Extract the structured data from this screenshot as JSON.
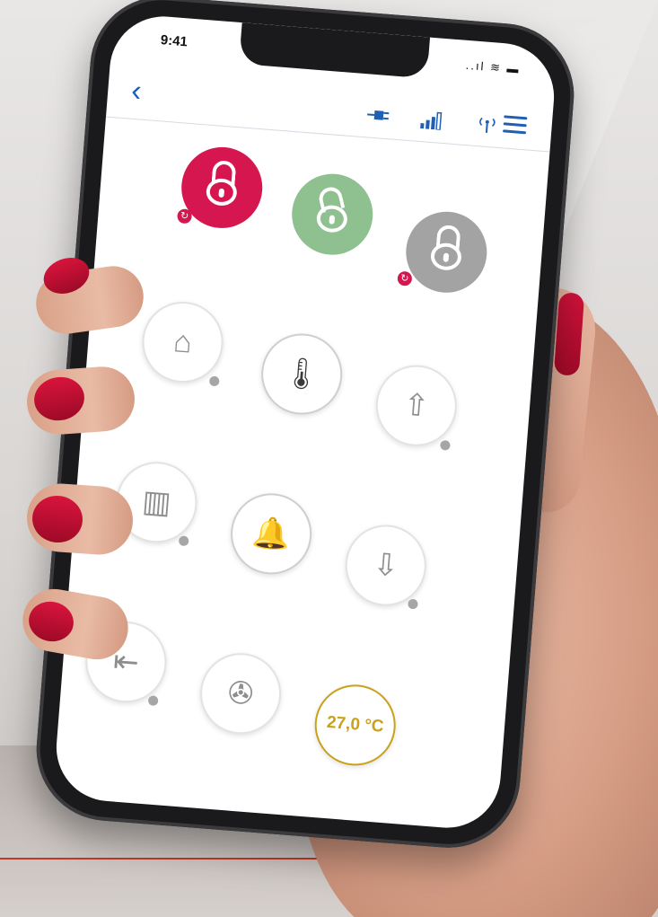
{
  "status_bar": {
    "time": "9:41",
    "signal": "..ıl",
    "wifi": "≋",
    "battery": "▬"
  },
  "topbar": {
    "back_label": "‹",
    "icons": [
      "plug-icon",
      "signal-bars-icon",
      "antenna-icon",
      "menu-icon"
    ],
    "accent_color": "#1f5fb4"
  },
  "tiles": {
    "lock_closed_red": {
      "color": "#d6164e",
      "icon": "lock-closed-icon",
      "sync_badge": "↻"
    },
    "lock_open_green": {
      "color": "#8fc08f",
      "icon": "lock-open-icon"
    },
    "lock_gray": {
      "color": "#a3a3a3",
      "icon": "lock-open-icon",
      "sync_badge": "↻"
    },
    "garage": {
      "icon": "garage-door-icon",
      "glyph": "⌂"
    },
    "thermostat": {
      "icon": "thermometer-icon",
      "glyph": "🌡"
    },
    "shutter_up": {
      "icon": "shutter-up-icon",
      "glyph": "⇧"
    },
    "gate_sliding": {
      "icon": "gate-icon",
      "glyph": "▥"
    },
    "alarm": {
      "icon": "bell-icon",
      "glyph": "🔔"
    },
    "shutter_down": {
      "icon": "shutter-down-icon",
      "glyph": "⇩"
    },
    "gate_open": {
      "icon": "sliding-gate-icon",
      "glyph": "⇤"
    },
    "fan": {
      "icon": "fan-icon",
      "glyph": "✇"
    },
    "temperature": {
      "value": "27,0 °C",
      "color": "#c9a21a"
    }
  }
}
